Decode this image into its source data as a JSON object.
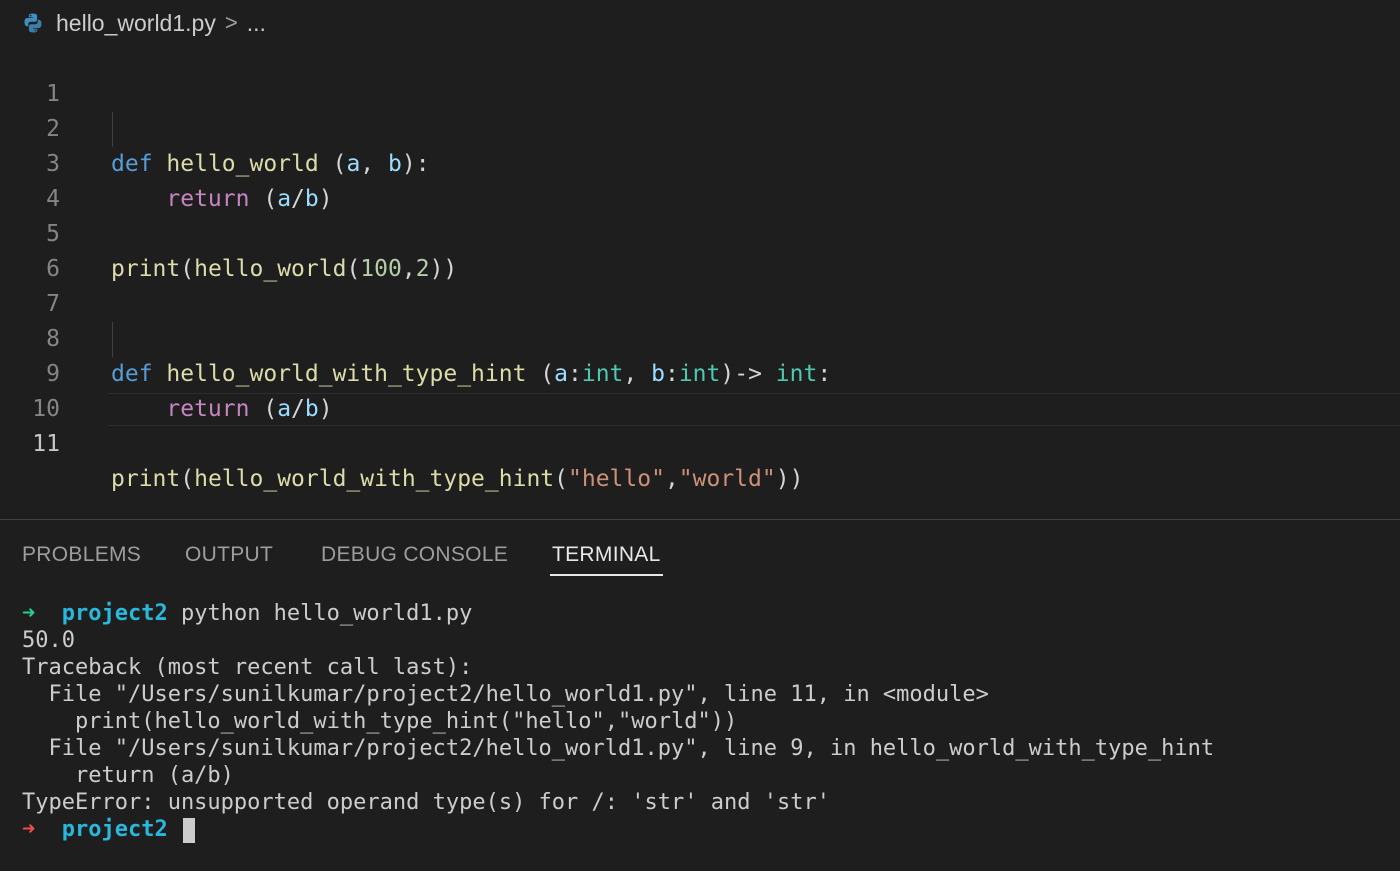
{
  "breadcrumb": {
    "file": "hello_world1.py",
    "separator": ">",
    "ellipsis": "...",
    "file_icon": "python-icon"
  },
  "editor": {
    "line_numbers": [
      "1",
      "2",
      "3",
      "4",
      "5",
      "6",
      "7",
      "8",
      "9",
      "10",
      "11"
    ],
    "current_line": "11",
    "lines": {
      "l2": {
        "def": "def",
        "fn": "hello_world",
        "sp": " (",
        "a": "a",
        "comma": ", ",
        "b": "b",
        "end": "):"
      },
      "l3": {
        "ret": "return",
        "open": " (",
        "a": "a",
        "slash": "/",
        "b": "b",
        "close": ")"
      },
      "l5": {
        "print": "print",
        "p1": "(",
        "fn": "hello_world",
        "p2": "(",
        "n1": "100",
        "c": ",",
        "n2": "2",
        "p3": "))"
      },
      "l8": {
        "def": "def",
        "fn": "hello_world_with_type_hint",
        "sp": " (",
        "a": "a",
        "col1": ":",
        "t1": "int",
        "comma": ", ",
        "b": "b",
        "col2": ":",
        "t2": "int",
        "arrow": ")-> ",
        "t3": "int",
        "end": ":"
      },
      "l9": {
        "ret": "return",
        "open": " (",
        "a": "a",
        "slash": "/",
        "b": "b",
        "close": ")"
      },
      "l11": {
        "print": "print",
        "p1": "(",
        "fn": "hello_world_with_type_hint",
        "p2": "(",
        "s1": "\"hello\"",
        "c": ",",
        "s2": "\"world\"",
        "p3": "))"
      }
    }
  },
  "panel": {
    "tabs": [
      "PROBLEMS",
      "OUTPUT",
      "DEBUG CONSOLE",
      "TERMINAL"
    ],
    "active_tab": "TERMINAL"
  },
  "terminal": {
    "prompt_arrow": "➜",
    "prompt_dir": "project2",
    "command": " python hello_world1.py",
    "output": [
      "50.0",
      "Traceback (most recent call last):",
      "  File \"/Users/sunilkumar/project2/hello_world1.py\", line 11, in <module>",
      "    print(hello_world_with_type_hint(\"hello\",\"world\"))",
      "  File \"/Users/sunilkumar/project2/hello_world1.py\", line 9, in hello_world_with_type_hint",
      "    return (a/b)",
      "TypeError: unsupported operand type(s) for /: 'str' and 'str'"
    ]
  },
  "colors": {
    "background": "#1e1e1e",
    "keyword": "#569cd6",
    "control": "#c586c0",
    "function": "#dcdcaa",
    "parameter": "#9cdcfe",
    "number": "#b5cea8",
    "string": "#ce9178",
    "type": "#4ec9b0",
    "prompt_ok": "#23d18b",
    "prompt_err": "#f14c4c",
    "directory": "#29b8db"
  }
}
